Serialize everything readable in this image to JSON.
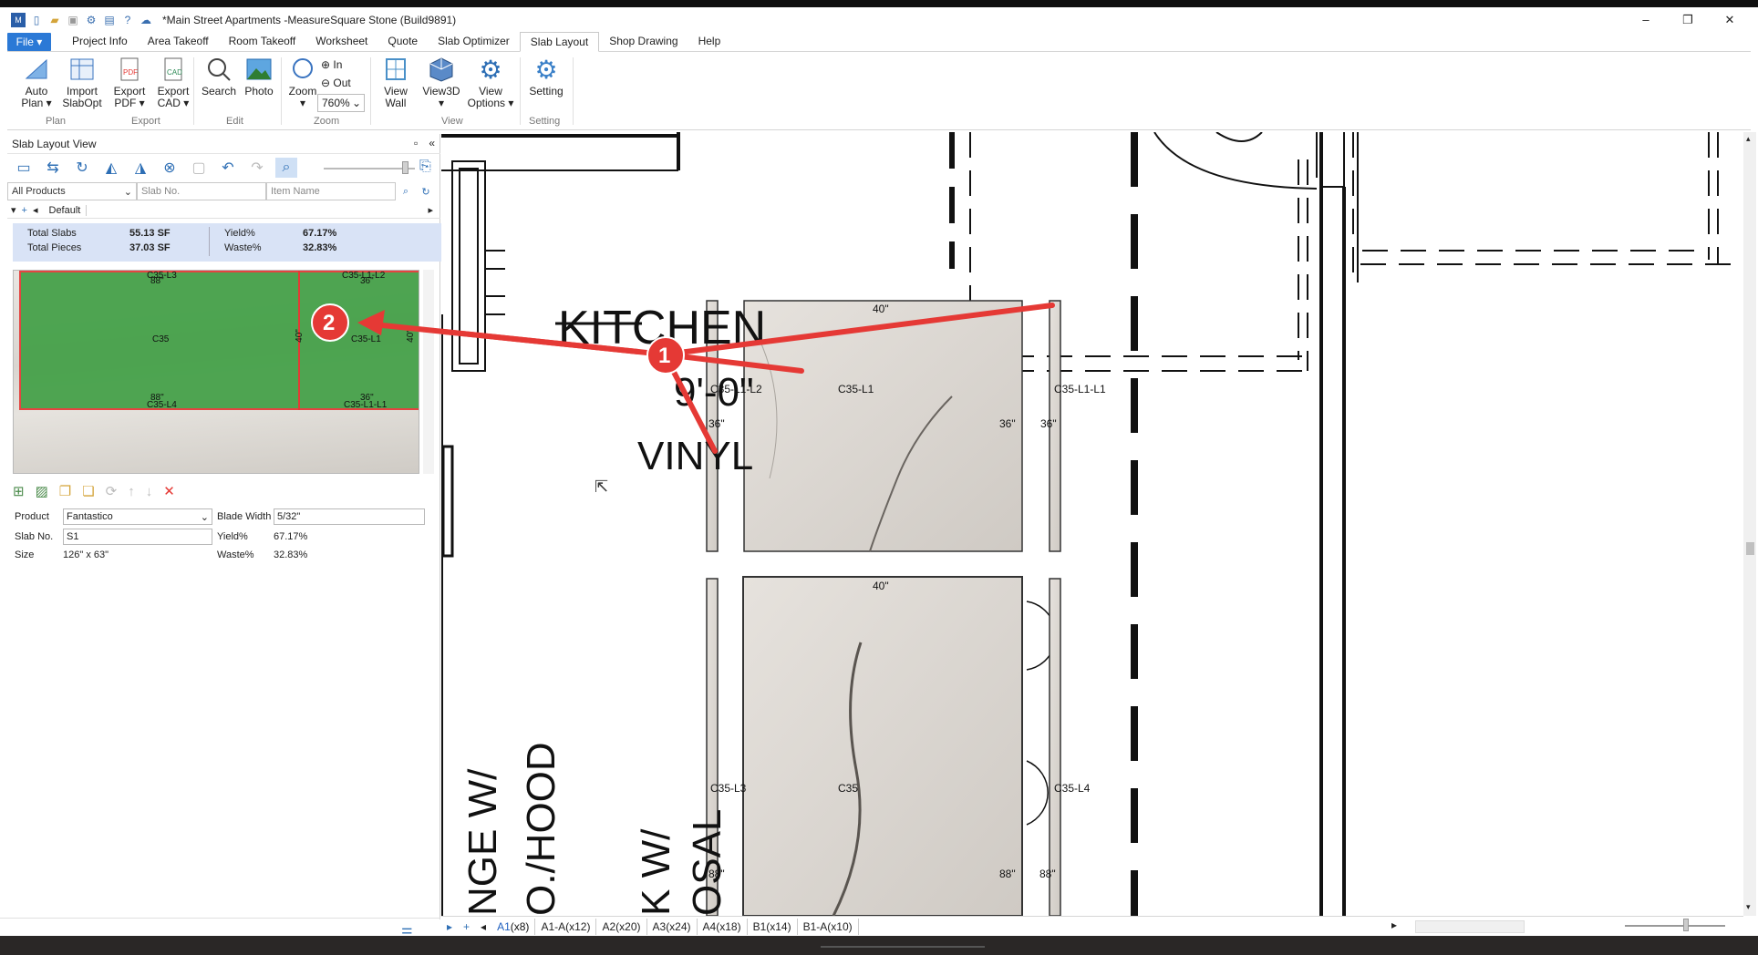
{
  "window": {
    "title": "*Main Street Apartments -MeasureSquare Stone (Build9891)",
    "minimize": "–",
    "restore": "❐",
    "close": "✕"
  },
  "menu": {
    "file": "File ▾",
    "tabs": [
      "Project Info",
      "Area Takeoff",
      "Room Takeoff",
      "Worksheet",
      "Quote",
      "Slab Optimizer",
      "Slab Layout",
      "Shop Drawing",
      "Help"
    ],
    "active_tab": "Slab Layout"
  },
  "ribbon": {
    "auto_plan": "Auto\nPlan ▾",
    "import_slabopt": "Import\nSlabOpt",
    "export_pdf": "Export\nPDF ▾",
    "export_cad": "Export\nCAD ▾",
    "search": "Search",
    "photo": "Photo",
    "zoom": "Zoom\n▾",
    "zoom_in": "In",
    "zoom_out": "Out",
    "zoom_level": "760%",
    "view_wall": "View\nWall",
    "view3d": "View3D\n▾",
    "view_options": "View\nOptions ▾",
    "setting": "Setting",
    "groups": {
      "plan": "Plan",
      "export": "Export",
      "edit": "Edit",
      "zoom": "Zoom",
      "view": "View",
      "setting": "Setting"
    }
  },
  "panel": {
    "title": "Slab Layout View",
    "filter_product": "All Products",
    "slab_no_placeholder": "Slab No.",
    "item_name_placeholder": "Item Name",
    "default_label": "Default",
    "summary": {
      "total_slabs_label": "Total Slabs",
      "total_slabs_value": "55.13 SF",
      "total_pieces_label": "Total Pieces",
      "total_pieces_value": "37.03 SF",
      "yield_label": "Yield%",
      "yield_value": "67.17%",
      "waste_label": "Waste%",
      "waste_value": "32.83%"
    },
    "slab_labels": {
      "c35_l3": "C35-L3",
      "c35_l1_l2": "C35-L1-L2",
      "c35": "C35",
      "c35_l1": "C35-L1",
      "c35_l4": "C35-L4",
      "c35_l1_l1": "C35-L1-L1",
      "d88a": "88\"",
      "d36a": "36\"",
      "d40a": "40\"",
      "d40b": "40\"",
      "d88b": "88\"",
      "d36b": "36\""
    },
    "props": {
      "product_label": "Product",
      "product_value": "Fantastico",
      "blade_width_label": "Blade Width",
      "blade_width_value": "5/32\"",
      "slab_no_label": "Slab No.",
      "slab_no_value": "S1",
      "yield_label": "Yield%",
      "yield_value": "67.17%",
      "size_label": "Size",
      "size_value": "126\" x 63\"",
      "waste_label": "Waste%",
      "waste_value": "32.83%"
    }
  },
  "canvas": {
    "kitchen_text": "KITCHEN",
    "dim_text": "9'-0\"",
    "vinyl_text": "VINYL",
    "range_text": "NGE W/",
    "hood_text": "O./HOOD",
    "sink_text": "K W/",
    "osal_text": "OSAL",
    "marker1": "1",
    "marker2": "2",
    "labels": {
      "c35_l1_l2": "C35-L1-L2",
      "c35_l1": "C35-L1",
      "c35_l1_l1": "C35-L1-L1",
      "c35_l3": "C35-L3",
      "c35": "C35",
      "c35_l4": "C35-L4",
      "d40a": "40\"",
      "d40b": "40\"",
      "d36a": "36\"",
      "d36b": "36\"",
      "d36c": "36\"",
      "d88a": "88\"",
      "d88b": "88\"",
      "d88c": "88\""
    },
    "arrow_color": "#e53935"
  },
  "sheet_tabs": [
    {
      "name": "A1",
      "count": "(x8)"
    },
    {
      "name": "A1-A",
      "count": "(x12)"
    },
    {
      "name": "A2",
      "count": "(x20)"
    },
    {
      "name": "A3",
      "count": "(x24)"
    },
    {
      "name": "A4",
      "count": "(x18)"
    },
    {
      "name": "B1",
      "count": "(x14)"
    },
    {
      "name": "B1-A",
      "count": "(x10)"
    }
  ]
}
